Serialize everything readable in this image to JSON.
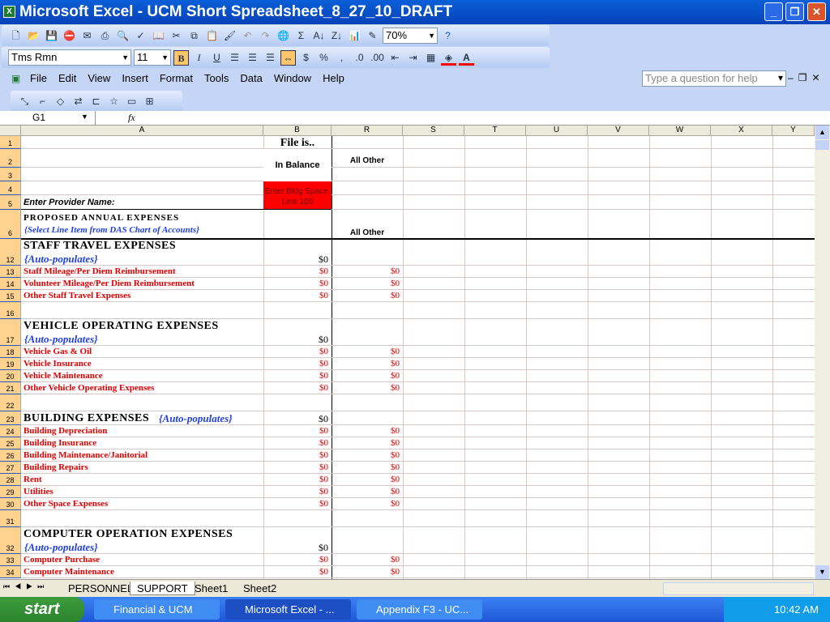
{
  "window": {
    "title": "Microsoft Excel - UCM Short Spreadsheet_8_27_10_DRAFT"
  },
  "toolbar": {
    "zoom": "70%",
    "font": "Tms Rmn",
    "size": "11"
  },
  "menu": [
    "File",
    "Edit",
    "View",
    "Insert",
    "Format",
    "Tools",
    "Data",
    "Window",
    "Help"
  ],
  "help_placeholder": "Type a question for help",
  "formula": {
    "name_box": "G1",
    "fx": "fx",
    "value": ""
  },
  "columns": [
    "A",
    "B",
    "R",
    "S",
    "T",
    "U",
    "V",
    "W",
    "X",
    "Y"
  ],
  "header": {
    "file_is": "File is..",
    "in_balance": "In Balance",
    "all_other_1": "All Other",
    "enter_bldg": "Enter Bldg Space, Line 105",
    "provider": "Enter Provider Name:",
    "proposed": "PROPOSED ANNUAL EXPENSES",
    "select": "{Select Line Item from DAS Chart of Accounts}",
    "all_other_2": "All Other"
  },
  "rows": [
    {
      "n": "12",
      "type": "section",
      "title": "STAFF TRAVEL EXPENSES",
      "auto": "{Auto-populates}",
      "b": "$0"
    },
    {
      "n": "13",
      "type": "item",
      "label": "Staff Mileage/Per Diem Reimbursement",
      "b": "$0",
      "r": "$0"
    },
    {
      "n": "14",
      "type": "item",
      "label": "Volunteer Mileage/Per Diem Reimbursement",
      "b": "$0",
      "r": "$0"
    },
    {
      "n": "15",
      "type": "item",
      "label": "Other Staff Travel Expenses",
      "b": "$0",
      "r": "$0"
    },
    {
      "n": "16",
      "type": "blank"
    },
    {
      "n": "17",
      "type": "section",
      "title": "VEHICLE OPERATING EXPENSES",
      "auto": "{Auto-populates}",
      "b": "$0"
    },
    {
      "n": "18",
      "type": "item",
      "label": "Vehicle Gas & Oil",
      "b": "$0",
      "r": "$0"
    },
    {
      "n": "19",
      "type": "item",
      "label": "Vehicle Insurance",
      "b": "$0",
      "r": "$0"
    },
    {
      "n": "20",
      "type": "item",
      "label": "Vehicle Maintenance",
      "b": "$0",
      "r": "$0"
    },
    {
      "n": "21",
      "type": "item",
      "label": "Other Vehicle Operating Expenses",
      "b": "$0",
      "r": "$0"
    },
    {
      "n": "22",
      "type": "blank"
    },
    {
      "n": "23",
      "type": "inline",
      "title": "BUILDING EXPENSES",
      "auto": "{Auto-populates}",
      "b": "$0"
    },
    {
      "n": "24",
      "type": "item",
      "label": "Building Depreciation",
      "b": "$0",
      "r": "$0"
    },
    {
      "n": "25",
      "type": "item",
      "label": "Building Insurance",
      "b": "$0",
      "r": "$0"
    },
    {
      "n": "26",
      "type": "item",
      "label": "Building Maintenance/Janitorial",
      "b": "$0",
      "r": "$0"
    },
    {
      "n": "27",
      "type": "item",
      "label": "Building Repairs",
      "b": "$0",
      "r": "$0"
    },
    {
      "n": "28",
      "type": "item",
      "label": "Rent",
      "b": "$0",
      "r": "$0"
    },
    {
      "n": "29",
      "type": "item",
      "label": "Utilities",
      "b": "$0",
      "r": "$0"
    },
    {
      "n": "30",
      "type": "item",
      "label": "Other Space Expenses",
      "b": "$0",
      "r": "$0"
    },
    {
      "n": "31",
      "type": "blank"
    },
    {
      "n": "32",
      "type": "section",
      "title": "COMPUTER OPERATION EXPENSES",
      "auto": "{Auto-populates}",
      "b": "$0"
    },
    {
      "n": "33",
      "type": "item",
      "label": "Computer Purchase",
      "b": "$0",
      "r": "$0"
    },
    {
      "n": "34",
      "type": "item",
      "label": "Computer Maintenance",
      "b": "$0",
      "r": "$0"
    }
  ],
  "sheets": [
    "PERSONNEL",
    "SUPPORT",
    "Sheet1",
    "Sheet2"
  ],
  "active_sheet": "SUPPORT",
  "taskbar": {
    "start": "start",
    "items": [
      "Financial & UCM",
      "Microsoft Excel - ...",
      "Appendix F3 - UC..."
    ],
    "clock": "10:42 AM"
  }
}
